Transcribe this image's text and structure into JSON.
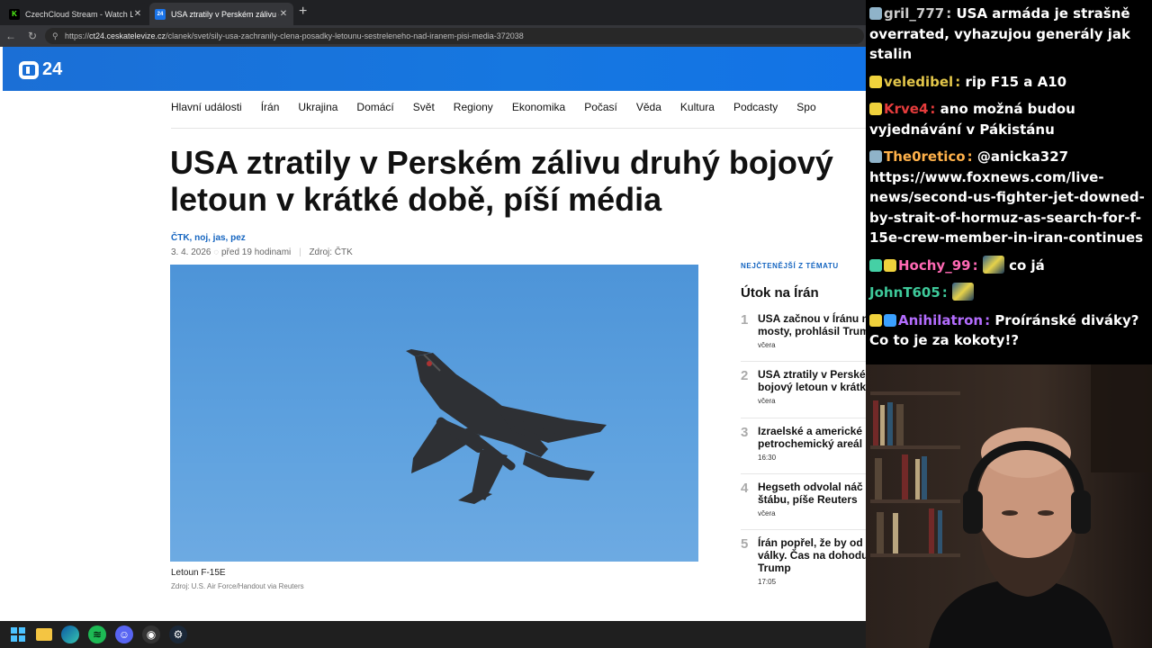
{
  "browser": {
    "tabs": [
      {
        "label": "CzechCloud Stream - Watch Live o",
        "favicon": "K",
        "favicon_color": "#53fc18"
      },
      {
        "label": "USA ztratily v Perském zálivu druh",
        "favicon": "24",
        "favicon_color": "#1a73e8"
      }
    ],
    "url_prefix": "https://",
    "url_domain": "ct24.ceskatelevize.cz",
    "url_path": "/clanek/svet/sily-usa-zachranily-clena-posadky-letounu-sestreleneho-nad-iranem-pisi-media-372038"
  },
  "site": {
    "logo": "24",
    "nav": [
      "Hlavní události",
      "Írán",
      "Ukrajina",
      "Domácí",
      "Svět",
      "Regiony",
      "Ekonomika",
      "Počasí",
      "Věda",
      "Kultura",
      "Podcasty",
      "Spo"
    ]
  },
  "article": {
    "headline": "USA ztratily v Perském zálivu druhý bojový letoun v krátké době, píší média",
    "authors": "ČTK, noj, jas, pez",
    "date": "3. 4. 2026",
    "ago": "před 19 hodinami",
    "source": "Zdroj: ČTK",
    "caption": "Letoun F-15E",
    "credit": "Zdroj: U.S. Air Force/Handout via Reuters"
  },
  "sidebar": {
    "kicker": "NEJČTENĚJŠÍ Z TÉMATU",
    "title": "Útok na Írán",
    "items": [
      {
        "num": "1",
        "text": "USA začnou v Íránu n\nmosty, prohlásil Trum",
        "time": "včera"
      },
      {
        "num": "2",
        "text": "USA ztratily v Perské\nbojový letoun v krátk",
        "time": "včera"
      },
      {
        "num": "3",
        "text": "Izraelské a americké\npetrochemický areál",
        "time": "16:30"
      },
      {
        "num": "4",
        "text": "Hegseth odvolal náč\nštábu, píše Reuters",
        "time": "včera"
      },
      {
        "num": "5",
        "text": "Írán popřel, že by od\nválky. Čas na dohodu\nTrump",
        "time": "17:05"
      }
    ]
  },
  "chat": [
    {
      "user": "gril_777",
      "color": "#cccccc",
      "badges": [
        "#8fb3c9"
      ],
      "text": "USA armáda je strašně overrated, vyhazujou generály jak stalin"
    },
    {
      "user": "veledibel",
      "color": "#e3c64a",
      "badges": [
        "#f0d23c"
      ],
      "text": "rip F15 a A10"
    },
    {
      "user": "Krve4",
      "color": "#e63c3c",
      "badges": [
        "#f0d23c"
      ],
      "text": "ano možná budou vyjednávání v Pákistánu"
    },
    {
      "user": "The0retico",
      "color": "#ffb14a",
      "badges": [
        "#8fb3c9"
      ],
      "text": "@anicka327 https://www.foxnews.com/live-news/second-us-fighter-jet-downed-by-strait-of-hormuz-as-search-for-f-15e-crew-member-in-iran-continues"
    },
    {
      "user": "Hochy_99",
      "color": "#ff69b4",
      "badges": [
        "#45d0a5",
        "#f0d23c"
      ],
      "text": "co já",
      "emote": true
    },
    {
      "user": "JohnT605",
      "color": "#3ec99a",
      "badges": [],
      "text": "",
      "emote": true
    },
    {
      "user": "Anihilatron",
      "color": "#b46dff",
      "badges": [
        "#f0d23c",
        "#3aa0ff"
      ],
      "text": "Proíránské diváky? Co to je za kokoty!?"
    }
  ],
  "taskbar": {
    "icons": [
      "windows-start",
      "file-explorer",
      "edge",
      "spotify",
      "discord",
      "obs",
      "steam"
    ]
  },
  "colors": {
    "header_blue": "#1677e0",
    "link_blue": "#1565c0"
  }
}
